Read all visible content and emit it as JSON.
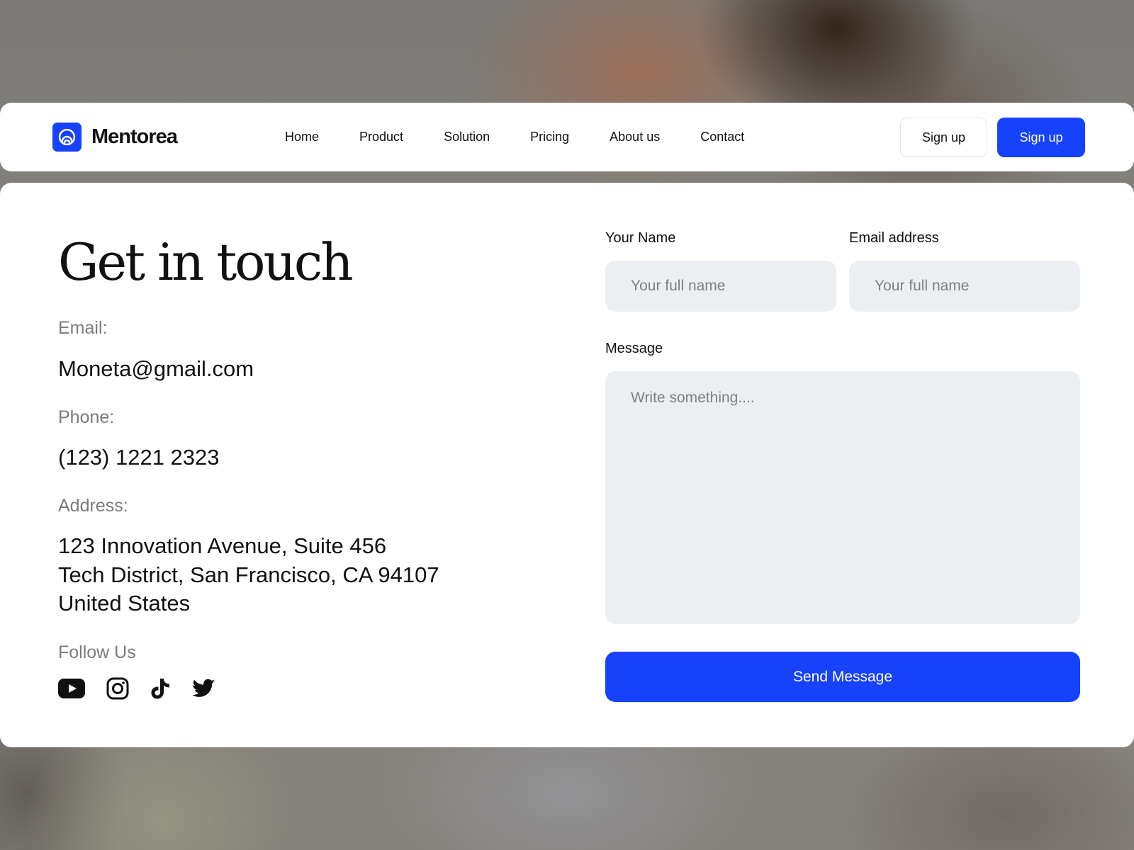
{
  "brand": {
    "name": "Mentorea",
    "accent": "#1642fb"
  },
  "nav": {
    "links": [
      "Home",
      "Product",
      "Solution",
      "Pricing",
      "About us",
      "Contact"
    ],
    "signup_outline": "Sign up",
    "signup_primary": "Sign up"
  },
  "contact": {
    "heading": "Get in touch",
    "email_label": "Email:",
    "email_value": "Moneta@gmail.com",
    "phone_label": "Phone:",
    "phone_value": "(123) 1221 2323",
    "address_label": "Address:",
    "address_lines": [
      "123 Innovation Avenue, Suite 456",
      "Tech District, San Francisco, CA 94107",
      "United States"
    ],
    "follow_label": "Follow Us",
    "socials": [
      "youtube-icon",
      "instagram-icon",
      "tiktok-icon",
      "twitter-icon"
    ]
  },
  "form": {
    "name_label": "Your Name",
    "name_placeholder": "Your full name",
    "email_label": "Email address",
    "email_placeholder": "Your full name",
    "message_label": "Message",
    "message_placeholder": "Write something....",
    "submit_label": "Send Message"
  }
}
